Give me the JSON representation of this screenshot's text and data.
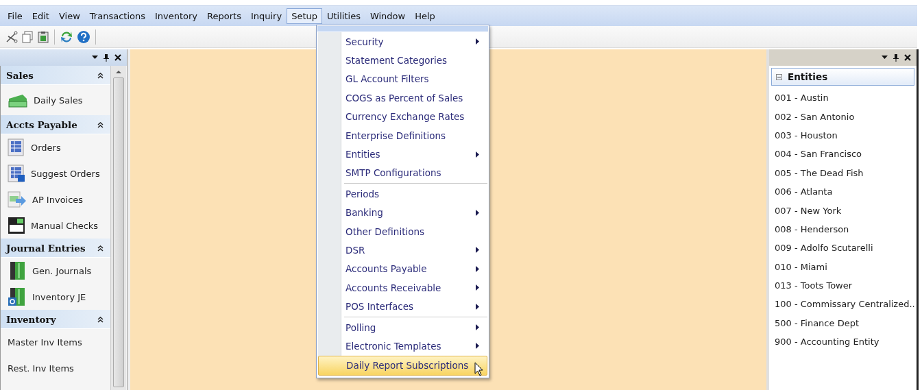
{
  "menubar": [
    {
      "label": "File",
      "selected": false
    },
    {
      "label": "Edit",
      "selected": false
    },
    {
      "label": "View",
      "selected": false
    },
    {
      "label": "Transactions",
      "selected": false
    },
    {
      "label": "Inventory",
      "selected": false
    },
    {
      "label": "Reports",
      "selected": false
    },
    {
      "label": "Inquiry",
      "selected": false
    },
    {
      "label": "Setup",
      "selected": true
    },
    {
      "label": "Utilities",
      "selected": false
    },
    {
      "label": "Window",
      "selected": false
    },
    {
      "label": "Help",
      "selected": false
    }
  ],
  "setup_menu": {
    "groups": [
      [
        {
          "label": "Security",
          "submenu": true,
          "selected": false
        },
        {
          "label": "Statement Categories",
          "submenu": false,
          "selected": false
        },
        {
          "label": "GL Account Filters",
          "submenu": false,
          "selected": false
        },
        {
          "label": "COGS as Percent of Sales",
          "submenu": false,
          "selected": false
        },
        {
          "label": "Currency Exchange Rates",
          "submenu": false,
          "selected": false
        },
        {
          "label": "Enterprise Definitions",
          "submenu": false,
          "selected": false
        },
        {
          "label": "Entities",
          "submenu": true,
          "selected": false
        },
        {
          "label": "SMTP Configurations",
          "submenu": false,
          "selected": false
        }
      ],
      [
        {
          "label": "Periods",
          "submenu": false,
          "selected": false
        },
        {
          "label": "Banking",
          "submenu": true,
          "selected": false
        },
        {
          "label": "Other Definitions",
          "submenu": false,
          "selected": false
        },
        {
          "label": "DSR",
          "submenu": true,
          "selected": false
        },
        {
          "label": "Accounts Payable",
          "submenu": true,
          "selected": false
        },
        {
          "label": "Accounts Receivable",
          "submenu": true,
          "selected": false
        },
        {
          "label": "POS Interfaces",
          "submenu": true,
          "selected": false
        }
      ],
      [
        {
          "label": "Polling",
          "submenu": true,
          "selected": false
        },
        {
          "label": "Electronic Templates",
          "submenu": true,
          "selected": false
        },
        {
          "label": "Daily Report Subscriptions",
          "submenu": false,
          "selected": true
        }
      ]
    ]
  },
  "sidebar": {
    "sections": [
      {
        "title": "Sales",
        "expanded": true,
        "items": [
          {
            "label": "Daily Sales",
            "kind": "money"
          }
        ]
      },
      {
        "title": "Accts Payable",
        "expanded": true,
        "items": [
          {
            "label": "Orders",
            "kind": "grid"
          },
          {
            "label": "Suggest Orders",
            "kind": "gridhelp"
          },
          {
            "label": "AP Invoices",
            "kind": "invoice"
          },
          {
            "label": "Manual Checks",
            "kind": "checks"
          }
        ]
      },
      {
        "title": "Journal Entries",
        "expanded": true,
        "items": [
          {
            "label": "Gen. Journals",
            "kind": "journal"
          },
          {
            "label": "Inventory JE",
            "kind": "journalgear"
          }
        ]
      },
      {
        "title": "Inventory",
        "expanded": true,
        "items": [
          {
            "label": "Master Inv Items",
            "kind": "plain"
          },
          {
            "label": "Rest. Inv Items",
            "kind": "plain"
          }
        ]
      }
    ]
  },
  "entities": {
    "title": "Entities",
    "expanded": true,
    "items": [
      "001 - Austin",
      "002 - San Antonio",
      "003 - Houston",
      "004 - San Francisco",
      "005 - The Dead Fish",
      "006 - Atlanta",
      "007 - New York",
      "008 - Henderson",
      "009 - Adolfo Scutarelli",
      "010 - Miami",
      "013 - Toots Tower",
      "100 - Commissary Centralized..",
      "500 - Finance Dept",
      "900 - Accounting Entity"
    ]
  }
}
